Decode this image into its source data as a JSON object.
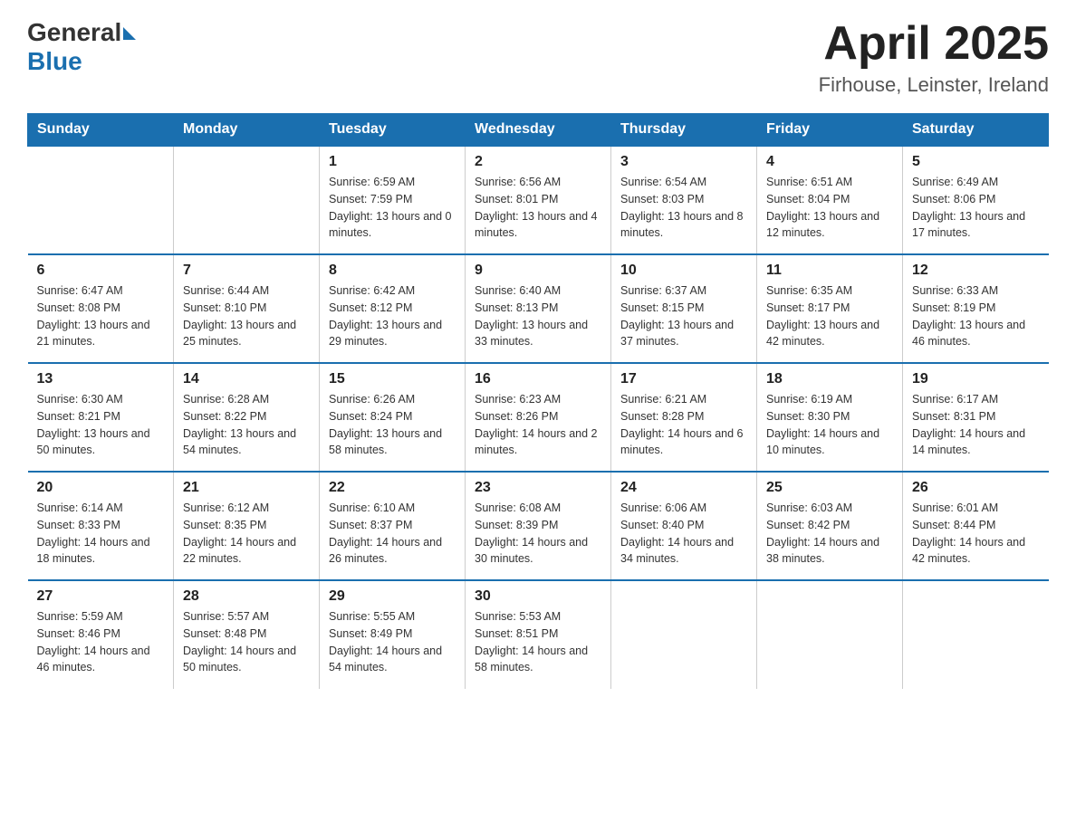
{
  "header": {
    "logo": {
      "general": "General",
      "blue": "Blue",
      "triangle": true
    },
    "title": "April 2025",
    "subtitle": "Firhouse, Leinster, Ireland"
  },
  "calendar": {
    "days_of_week": [
      "Sunday",
      "Monday",
      "Tuesday",
      "Wednesday",
      "Thursday",
      "Friday",
      "Saturday"
    ],
    "weeks": [
      [
        {
          "day": "",
          "sunrise": "",
          "sunset": "",
          "daylight": ""
        },
        {
          "day": "",
          "sunrise": "",
          "sunset": "",
          "daylight": ""
        },
        {
          "day": "1",
          "sunrise": "Sunrise: 6:59 AM",
          "sunset": "Sunset: 7:59 PM",
          "daylight": "Daylight: 13 hours and 0 minutes."
        },
        {
          "day": "2",
          "sunrise": "Sunrise: 6:56 AM",
          "sunset": "Sunset: 8:01 PM",
          "daylight": "Daylight: 13 hours and 4 minutes."
        },
        {
          "day": "3",
          "sunrise": "Sunrise: 6:54 AM",
          "sunset": "Sunset: 8:03 PM",
          "daylight": "Daylight: 13 hours and 8 minutes."
        },
        {
          "day": "4",
          "sunrise": "Sunrise: 6:51 AM",
          "sunset": "Sunset: 8:04 PM",
          "daylight": "Daylight: 13 hours and 12 minutes."
        },
        {
          "day": "5",
          "sunrise": "Sunrise: 6:49 AM",
          "sunset": "Sunset: 8:06 PM",
          "daylight": "Daylight: 13 hours and 17 minutes."
        }
      ],
      [
        {
          "day": "6",
          "sunrise": "Sunrise: 6:47 AM",
          "sunset": "Sunset: 8:08 PM",
          "daylight": "Daylight: 13 hours and 21 minutes."
        },
        {
          "day": "7",
          "sunrise": "Sunrise: 6:44 AM",
          "sunset": "Sunset: 8:10 PM",
          "daylight": "Daylight: 13 hours and 25 minutes."
        },
        {
          "day": "8",
          "sunrise": "Sunrise: 6:42 AM",
          "sunset": "Sunset: 8:12 PM",
          "daylight": "Daylight: 13 hours and 29 minutes."
        },
        {
          "day": "9",
          "sunrise": "Sunrise: 6:40 AM",
          "sunset": "Sunset: 8:13 PM",
          "daylight": "Daylight: 13 hours and 33 minutes."
        },
        {
          "day": "10",
          "sunrise": "Sunrise: 6:37 AM",
          "sunset": "Sunset: 8:15 PM",
          "daylight": "Daylight: 13 hours and 37 minutes."
        },
        {
          "day": "11",
          "sunrise": "Sunrise: 6:35 AM",
          "sunset": "Sunset: 8:17 PM",
          "daylight": "Daylight: 13 hours and 42 minutes."
        },
        {
          "day": "12",
          "sunrise": "Sunrise: 6:33 AM",
          "sunset": "Sunset: 8:19 PM",
          "daylight": "Daylight: 13 hours and 46 minutes."
        }
      ],
      [
        {
          "day": "13",
          "sunrise": "Sunrise: 6:30 AM",
          "sunset": "Sunset: 8:21 PM",
          "daylight": "Daylight: 13 hours and 50 minutes."
        },
        {
          "day": "14",
          "sunrise": "Sunrise: 6:28 AM",
          "sunset": "Sunset: 8:22 PM",
          "daylight": "Daylight: 13 hours and 54 minutes."
        },
        {
          "day": "15",
          "sunrise": "Sunrise: 6:26 AM",
          "sunset": "Sunset: 8:24 PM",
          "daylight": "Daylight: 13 hours and 58 minutes."
        },
        {
          "day": "16",
          "sunrise": "Sunrise: 6:23 AM",
          "sunset": "Sunset: 8:26 PM",
          "daylight": "Daylight: 14 hours and 2 minutes."
        },
        {
          "day": "17",
          "sunrise": "Sunrise: 6:21 AM",
          "sunset": "Sunset: 8:28 PM",
          "daylight": "Daylight: 14 hours and 6 minutes."
        },
        {
          "day": "18",
          "sunrise": "Sunrise: 6:19 AM",
          "sunset": "Sunset: 8:30 PM",
          "daylight": "Daylight: 14 hours and 10 minutes."
        },
        {
          "day": "19",
          "sunrise": "Sunrise: 6:17 AM",
          "sunset": "Sunset: 8:31 PM",
          "daylight": "Daylight: 14 hours and 14 minutes."
        }
      ],
      [
        {
          "day": "20",
          "sunrise": "Sunrise: 6:14 AM",
          "sunset": "Sunset: 8:33 PM",
          "daylight": "Daylight: 14 hours and 18 minutes."
        },
        {
          "day": "21",
          "sunrise": "Sunrise: 6:12 AM",
          "sunset": "Sunset: 8:35 PM",
          "daylight": "Daylight: 14 hours and 22 minutes."
        },
        {
          "day": "22",
          "sunrise": "Sunrise: 6:10 AM",
          "sunset": "Sunset: 8:37 PM",
          "daylight": "Daylight: 14 hours and 26 minutes."
        },
        {
          "day": "23",
          "sunrise": "Sunrise: 6:08 AM",
          "sunset": "Sunset: 8:39 PM",
          "daylight": "Daylight: 14 hours and 30 minutes."
        },
        {
          "day": "24",
          "sunrise": "Sunrise: 6:06 AM",
          "sunset": "Sunset: 8:40 PM",
          "daylight": "Daylight: 14 hours and 34 minutes."
        },
        {
          "day": "25",
          "sunrise": "Sunrise: 6:03 AM",
          "sunset": "Sunset: 8:42 PM",
          "daylight": "Daylight: 14 hours and 38 minutes."
        },
        {
          "day": "26",
          "sunrise": "Sunrise: 6:01 AM",
          "sunset": "Sunset: 8:44 PM",
          "daylight": "Daylight: 14 hours and 42 minutes."
        }
      ],
      [
        {
          "day": "27",
          "sunrise": "Sunrise: 5:59 AM",
          "sunset": "Sunset: 8:46 PM",
          "daylight": "Daylight: 14 hours and 46 minutes."
        },
        {
          "day": "28",
          "sunrise": "Sunrise: 5:57 AM",
          "sunset": "Sunset: 8:48 PM",
          "daylight": "Daylight: 14 hours and 50 minutes."
        },
        {
          "day": "29",
          "sunrise": "Sunrise: 5:55 AM",
          "sunset": "Sunset: 8:49 PM",
          "daylight": "Daylight: 14 hours and 54 minutes."
        },
        {
          "day": "30",
          "sunrise": "Sunrise: 5:53 AM",
          "sunset": "Sunset: 8:51 PM",
          "daylight": "Daylight: 14 hours and 58 minutes."
        },
        {
          "day": "",
          "sunrise": "",
          "sunset": "",
          "daylight": ""
        },
        {
          "day": "",
          "sunrise": "",
          "sunset": "",
          "daylight": ""
        },
        {
          "day": "",
          "sunrise": "",
          "sunset": "",
          "daylight": ""
        }
      ]
    ]
  }
}
